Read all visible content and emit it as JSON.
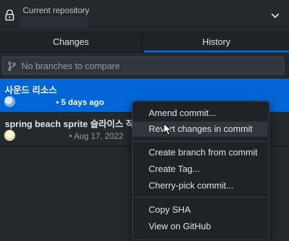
{
  "header": {
    "repo_caption": "Current repository",
    "lock_icon": "lock-icon",
    "dropdown_icon": "chevron-down-icon"
  },
  "tabs": [
    {
      "label": "Changes",
      "selected": false
    },
    {
      "label": "History",
      "selected": true
    }
  ],
  "compare": {
    "icon": "git-branch-icon",
    "placeholder": "No branches to compare"
  },
  "commits": [
    {
      "title": "사운드 리소스",
      "meta": "• 5 days ago",
      "selected": true
    },
    {
      "title": "spring beach sprite 슬라이스 작업",
      "meta": "• Aug 17, 2022",
      "selected": false
    }
  ],
  "context_menu": {
    "items": [
      "Amend commit...",
      "Revert changes in commit",
      "Create branch from commit",
      "Create Tag...",
      "Cherry-pick commit...",
      "Copy SHA",
      "View on GitHub"
    ],
    "hovered": "Revert changes in commit"
  },
  "colors": {
    "background": "#24292e",
    "accent": "#0366d6",
    "menu_bg": "#1f2327"
  }
}
